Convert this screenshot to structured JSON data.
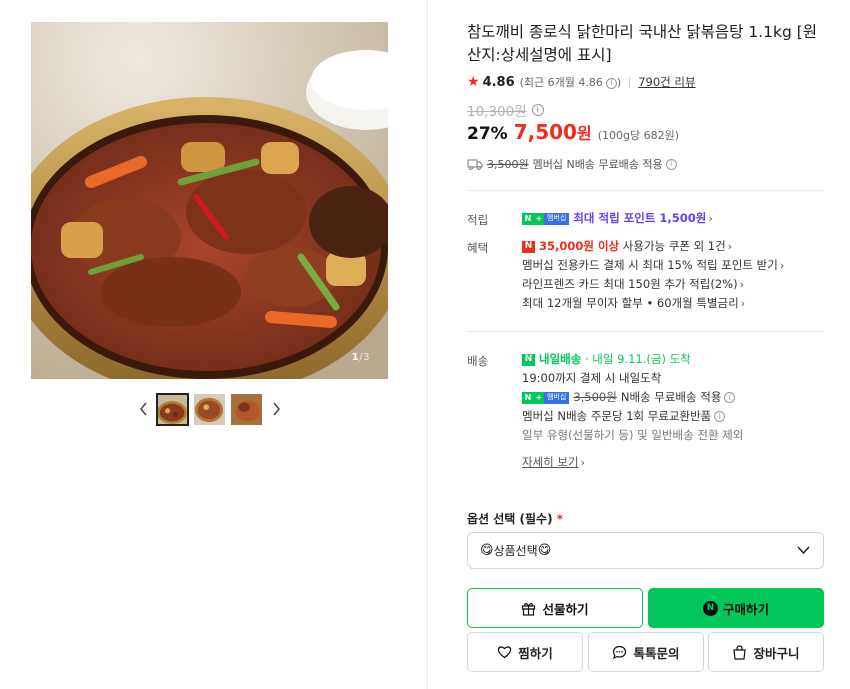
{
  "gallery": {
    "counter_current": "1",
    "counter_total": "/3",
    "prev_icon": "chevron-left-icon",
    "next_icon": "chevron-right-icon",
    "thumbnail_count": 3
  },
  "product": {
    "title": "참도깨비 종로식 닭한마리 국내산 닭볶음탕 1.1kg [원산지:상세설명에 표시]",
    "rating": "4.86",
    "rating_sub": "(최근 6개월 4.86",
    "rating_sub_close": ")",
    "reviews": "790건 리뷰",
    "original_price": "10,300원",
    "discount": "27%",
    "sale_price": "7,500",
    "sale_unit": "원",
    "unit_price": "(100g당 682원)",
    "ship_original": "3,500원",
    "ship_text": "멤버십 N배송 무료배송 적용"
  },
  "benefits": {
    "points_label": "적립",
    "points_badge_member": "멤버십",
    "points_text": "최대 적립 포인트 1,500원",
    "perks_label": "혜택",
    "coupon_amount": "35,000원 이상",
    "coupon_text": "사용가능 쿠폰 외 1건",
    "line2": "멤버십 전용카드 결제 시 최대 15% 적립 포인트 받기",
    "line3": "라인프렌즈 카드 최대 150원 추가 적립(2%)",
    "line4": "최대 12개월 무이자 할부 • 60개월 특별금리"
  },
  "delivery": {
    "label": "배송",
    "tomorrow": "내일배송",
    "tomorrow_date": "· 내일 9.11.(금) 도착",
    "cutoff": "19:00까지 결제 시 내일도착",
    "member_badge": "멤버십",
    "fee_original": "3,500원",
    "fee_text": "N배송 무료배송 적용",
    "exchange": "멤버십 N배송 주문당 1회 무료교환반품",
    "exclude": "일부 유형(선물하기 등) 및 일반배송 전환 제외",
    "detail_link": "자세히 보기"
  },
  "options": {
    "label": "옵션 선택 (필수)",
    "required_mark": "*",
    "select_value": "상품선택",
    "select_emoji": "😋"
  },
  "actions": {
    "gift": "선물하기",
    "buy": "구매하기",
    "wish": "찜하기",
    "talk": "톡톡문의",
    "cart": "장바구니"
  },
  "colors": {
    "naver_green": "#03c75a",
    "sale_red": "#f02d1d",
    "point_purple": "#6b3fe8"
  }
}
